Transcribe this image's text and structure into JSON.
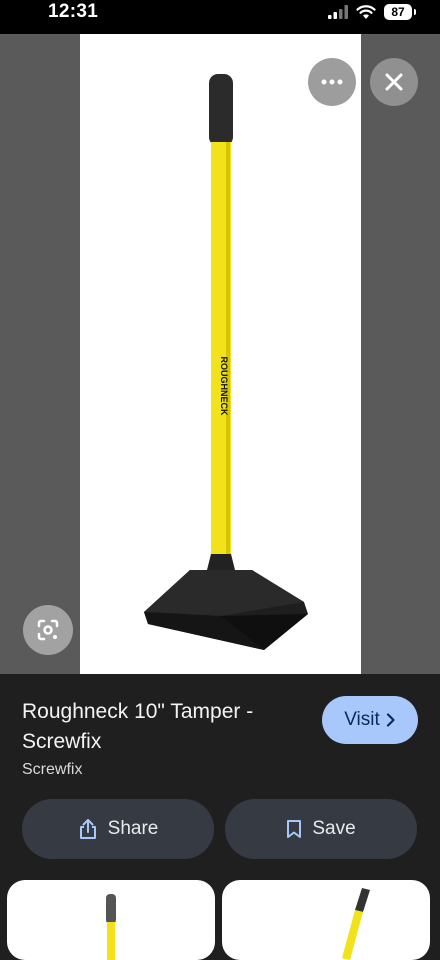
{
  "status_bar": {
    "time": "12:31",
    "battery": "87",
    "icons": [
      "signal-icon",
      "wifi-icon",
      "battery-icon"
    ]
  },
  "viewer": {
    "image_alt": "Roughneck 10\" Tamper",
    "handle_text": "ROUGHNECK",
    "icons": [
      "more-icon",
      "close-icon",
      "lens-icon"
    ]
  },
  "result": {
    "title": "Roughneck 10\" Tamper - Screwfix",
    "source": "Screwfix",
    "visit_label": "Visit",
    "share_label": "Share",
    "save_label": "Save"
  },
  "colors": {
    "background": "#1f1f1f",
    "viewer_bg": "#5a5a5a",
    "visit_button": "#a8c7fa",
    "action_button": "#363a42",
    "handle_yellow": "#f2e21b"
  }
}
